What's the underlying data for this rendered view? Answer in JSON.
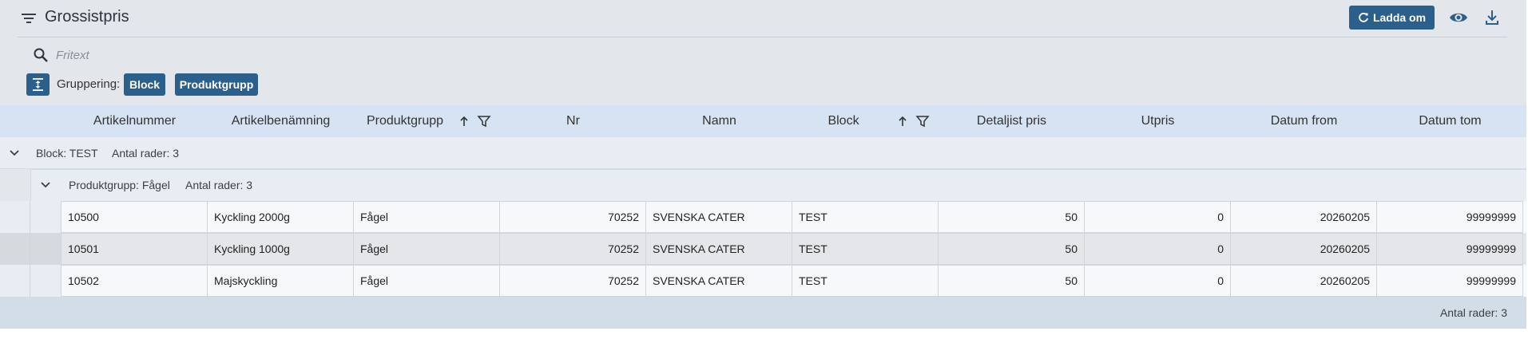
{
  "header": {
    "title": "Grossistpris",
    "reload_label": "Ladda om",
    "icons": {
      "filter": "filter-lines-icon",
      "reload": "refresh-icon",
      "view": "eye-icon",
      "download": "download-icon"
    }
  },
  "search": {
    "placeholder": "Fritext",
    "value": ""
  },
  "grouping": {
    "label": "Gruppering:",
    "chips": [
      "Block",
      "Produktgrupp"
    ]
  },
  "table": {
    "columns": [
      "Artikelnummer",
      "Artikelbenämning",
      "Produktgrupp",
      "Nr",
      "Namn",
      "Block",
      "Detaljist pris",
      "Utpris",
      "Datum from",
      "Datum tom"
    ],
    "group_level1": {
      "label": "Block: TEST",
      "count": "Antal rader: 3"
    },
    "group_level2": {
      "label": "Produktgrupp: Fågel",
      "count": "Antal rader: 3"
    },
    "rows": [
      [
        "10500",
        "Kyckling 2000g",
        "Fågel",
        "70252",
        "SVENSKA CATER",
        "TEST",
        "50",
        "0",
        "20260205",
        "99999999"
      ],
      [
        "10501",
        "Kyckling 1000g",
        "Fågel",
        "70252",
        "SVENSKA CATER",
        "TEST",
        "50",
        "0",
        "20260205",
        "99999999"
      ],
      [
        "10502",
        "Majskyckling",
        "Fågel",
        "70252",
        "SVENSKA CATER",
        "TEST",
        "50",
        "0",
        "20260205",
        "99999999"
      ]
    ],
    "footer": "Antal rader: 3"
  },
  "colors": {
    "accent": "#2b5f8c",
    "header_bg": "#d5e3f3",
    "panel_bg": "#e3e6ea"
  }
}
